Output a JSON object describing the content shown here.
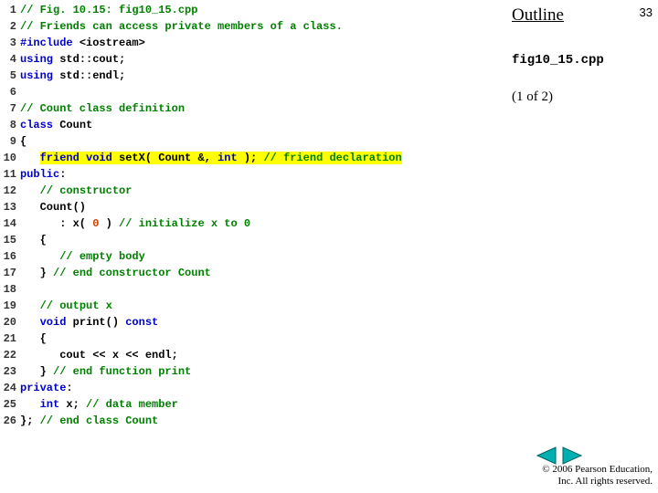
{
  "sidebar": {
    "outline": "Outline",
    "page_number": "33",
    "filename": "fig10_15.cpp",
    "page_part": "(1 of 2)"
  },
  "copyright": {
    "line1": "© 2006 Pearson Education,",
    "line2": "Inc.  All rights reserved."
  },
  "code": [
    {
      "n": "1",
      "tokens": [
        {
          "t": "// Fig. 10.15: fig10_15.cpp",
          "c": "cmt"
        }
      ]
    },
    {
      "n": "2",
      "tokens": [
        {
          "t": "// Friends can access private members of a class.",
          "c": "cmt"
        }
      ]
    },
    {
      "n": "3",
      "tokens": [
        {
          "t": "#include ",
          "c": "kw"
        },
        {
          "t": "<iostream>",
          "c": ""
        }
      ]
    },
    {
      "n": "4",
      "tokens": [
        {
          "t": "using",
          "c": "kw"
        },
        {
          "t": " std::cout;",
          "c": ""
        }
      ]
    },
    {
      "n": "5",
      "tokens": [
        {
          "t": "using",
          "c": "kw"
        },
        {
          "t": " std::endl;",
          "c": ""
        }
      ]
    },
    {
      "n": "6",
      "tokens": [
        {
          "t": "",
          "c": ""
        }
      ]
    },
    {
      "n": "7",
      "tokens": [
        {
          "t": "// Count class definition",
          "c": "cmt"
        }
      ]
    },
    {
      "n": "8",
      "tokens": [
        {
          "t": "class",
          "c": "kw"
        },
        {
          "t": " Count",
          "c": ""
        }
      ]
    },
    {
      "n": "9",
      "tokens": [
        {
          "t": "{",
          "c": ""
        }
      ]
    },
    {
      "n": "10",
      "tokens": [
        {
          "t": "   ",
          "c": ""
        },
        {
          "t": "friend void",
          "c": "kw hl"
        },
        {
          "t": " setX( Count &, ",
          "c": "hl"
        },
        {
          "t": "int",
          "c": "kw hl"
        },
        {
          "t": " ); ",
          "c": "hl"
        },
        {
          "t": "// friend declaration",
          "c": "cmt hl"
        }
      ]
    },
    {
      "n": "11",
      "tokens": [
        {
          "t": "public",
          "c": "kw"
        },
        {
          "t": ":",
          "c": ""
        }
      ]
    },
    {
      "n": "12",
      "tokens": [
        {
          "t": "   ",
          "c": ""
        },
        {
          "t": "// constructor",
          "c": "cmt"
        }
      ]
    },
    {
      "n": "13",
      "tokens": [
        {
          "t": "   Count()",
          "c": ""
        }
      ]
    },
    {
      "n": "14",
      "tokens": [
        {
          "t": "      : x( ",
          "c": ""
        },
        {
          "t": "0",
          "c": "num"
        },
        {
          "t": " ) ",
          "c": ""
        },
        {
          "t": "// initialize x to 0",
          "c": "cmt"
        }
      ]
    },
    {
      "n": "15",
      "tokens": [
        {
          "t": "   {",
          "c": ""
        }
      ]
    },
    {
      "n": "16",
      "tokens": [
        {
          "t": "      ",
          "c": ""
        },
        {
          "t": "// empty body",
          "c": "cmt"
        }
      ]
    },
    {
      "n": "17",
      "tokens": [
        {
          "t": "   } ",
          "c": ""
        },
        {
          "t": "// end constructor Count",
          "c": "cmt"
        }
      ]
    },
    {
      "n": "18",
      "tokens": [
        {
          "t": "",
          "c": ""
        }
      ]
    },
    {
      "n": "19",
      "tokens": [
        {
          "t": "   ",
          "c": ""
        },
        {
          "t": "// output x",
          "c": "cmt"
        }
      ]
    },
    {
      "n": "20",
      "tokens": [
        {
          "t": "   ",
          "c": ""
        },
        {
          "t": "void",
          "c": "kw"
        },
        {
          "t": " print() ",
          "c": ""
        },
        {
          "t": "const",
          "c": "kw"
        }
      ]
    },
    {
      "n": "21",
      "tokens": [
        {
          "t": "   {",
          "c": ""
        }
      ]
    },
    {
      "n": "22",
      "tokens": [
        {
          "t": "      cout << x << endl;",
          "c": ""
        }
      ]
    },
    {
      "n": "23",
      "tokens": [
        {
          "t": "   } ",
          "c": ""
        },
        {
          "t": "// end function print",
          "c": "cmt"
        }
      ]
    },
    {
      "n": "24",
      "tokens": [
        {
          "t": "private",
          "c": "kw"
        },
        {
          "t": ":",
          "c": ""
        }
      ]
    },
    {
      "n": "25",
      "tokens": [
        {
          "t": "   ",
          "c": ""
        },
        {
          "t": "int",
          "c": "kw"
        },
        {
          "t": " x; ",
          "c": ""
        },
        {
          "t": "// data member",
          "c": "cmt"
        }
      ]
    },
    {
      "n": "26",
      "tokens": [
        {
          "t": "}; ",
          "c": ""
        },
        {
          "t": "// end class Count",
          "c": "cmt"
        }
      ]
    }
  ]
}
